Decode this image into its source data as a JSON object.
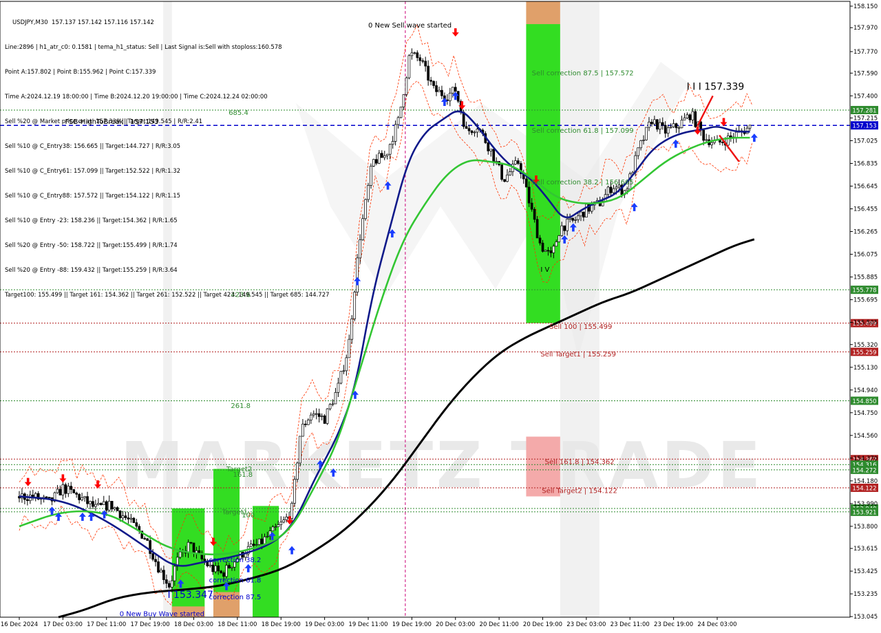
{
  "header_lines": [
    "USDJPY,M30  157.137 157.142 157.116 157.142",
    "Line:2896 | h1_atr_c0: 0.1581 | tema_h1_status: Sell | Last Signal is:Sell with stoploss:160.578",
    "Point A:157.802 | Point B:155.962 | Point C:157.339",
    "Time A:2024.12.19 18:00:00 | Time B:2024.12.20 19:00:00 | Time C:2024.12.24 02:00:00",
    "Sell %20 @ Market price or at: 157.339 || Target:149.545 | R/R:2.41",
    "Sell %10 @ C_Entry38: 156.665 || Target:144.727 | R/R:3.05",
    "Sell %10 @ C_Entry61: 157.099 || Target:152.522 | R/R:1.32",
    "Sell %10 @ C_Entry88: 157.572 || Target:154.122 | R/R:1.15",
    "Sell %10 @ Entry -23: 158.236 || Target:154.362 | R/R:1.65",
    "Sell %20 @ Entry -50: 158.722 || Target:155.499 | R/R:1.74",
    "Sell %20 @ Entry -88: 159.432 || Target:155.259 | R/R:3.64",
    "Target100: 155.499 || Target 161: 154.362 || Target 261: 152.522 || Target 423: 149.545 || Target 685: 144.727"
  ],
  "colors": {
    "candle": "#000000",
    "ma_blue": "#101a8a",
    "ma_green": "#33c633",
    "ma_black": "#000000",
    "envelope": "#ff3300",
    "level_green": "#2e8b2e",
    "level_red": "#b22222",
    "level_blue": "#0000cc",
    "zone_green": "#33dd22",
    "zone_orange": "#e0a06a",
    "zone_pink": "#f4aaaa",
    "grey_bar": "#e8e8e8",
    "arrow_up": "#1a3dff",
    "arrow_down": "#ff0000",
    "watermark": "#cfcfcf"
  },
  "chart_data": {
    "type": "candlestick",
    "symbol": "USDJPY",
    "timeframe": "M30",
    "ylim": [
      153.04,
      158.19
    ],
    "y_ticks": [
      158.15,
      157.97,
      157.77,
      157.59,
      157.4,
      157.215,
      157.025,
      156.835,
      156.645,
      156.455,
      156.265,
      156.075,
      155.885,
      155.695,
      155.505,
      155.32,
      155.13,
      154.94,
      154.75,
      154.56,
      154.37,
      154.18,
      153.99,
      153.8,
      153.615,
      153.425,
      153.235,
      153.045
    ],
    "y_tick_labels": [
      "158.150",
      "157.970",
      "157.770",
      "157.590",
      "157.400",
      "157.215",
      "157.025",
      "156.835",
      "156.645",
      "156.455",
      "156.265",
      "156.075",
      "155.885",
      "155.695",
      "155.505",
      "155.320",
      "155.130",
      "154.940",
      "154.750",
      "154.560",
      "154.370",
      "154.180",
      "153.990",
      "153.800",
      "153.615",
      "153.425",
      "153.235",
      "153.045"
    ],
    "x_labels": [
      "16 Dec 2024",
      "17 Dec 03:00",
      "17 Dec 11:00",
      "17 Dec 19:00",
      "18 Dec 03:00",
      "18 Dec 11:00",
      "18 Dec 19:00",
      "19 Dec 03:00",
      "19 Dec 11:00",
      "19 Dec 19:00",
      "20 Dec 03:00",
      "20 Dec 11:00",
      "20 Dec 19:00",
      "23 Dec 03:00",
      "23 Dec 11:00",
      "23 Dec 19:00",
      "24 Dec 03:00"
    ],
    "x_range": [
      0,
      17
    ],
    "levels": [
      {
        "price": 157.281,
        "label": "157.281",
        "color": "#2e8b2e",
        "style": "dotted"
      },
      {
        "price": 157.153,
        "label": "157.153",
        "color": "#0000cc",
        "style": "dashed"
      },
      {
        "price": 155.778,
        "label": "155.778",
        "color": "#2e8b2e",
        "style": "dotted"
      },
      {
        "price": 155.499,
        "label": "155.499",
        "color": "#b22222",
        "style": "dotted"
      },
      {
        "price": 155.259,
        "label": "155.259",
        "color": "#b22222",
        "style": "dotted"
      },
      {
        "price": 154.85,
        "label": "154.850",
        "color": "#2e8b2e",
        "style": "dotted"
      },
      {
        "price": 154.362,
        "label": "154.362",
        "color": "#b22222",
        "style": "dotted"
      },
      {
        "price": 154.316,
        "label": "154.316",
        "color": "#2e8b2e",
        "style": "dotted"
      },
      {
        "price": 154.272,
        "label": "154.272",
        "color": "#2e8b2e",
        "style": "dotted"
      },
      {
        "price": 154.122,
        "label": "154.122",
        "color": "#b22222",
        "style": "dotted"
      },
      {
        "price": 153.949,
        "label": "153.949",
        "color": "#2e8b2e",
        "style": "dotted"
      },
      {
        "price": 153.921,
        "label": "153.921",
        "color": "#2e8b2e",
        "style": "dotted"
      }
    ],
    "annotations": [
      {
        "text": "FSB-HighToBreak | 157.153",
        "x": 1.05,
        "price": 157.165,
        "color": "#000000"
      },
      {
        "text": "685.4",
        "x": 4.8,
        "price": 157.24,
        "color": "#2e8b2e"
      },
      {
        "text": "423.6",
        "x": 4.85,
        "price": 155.72,
        "color": "#2e8b2e"
      },
      {
        "text": "261.8",
        "x": 4.85,
        "price": 154.79,
        "color": "#2e8b2e"
      },
      {
        "text": "Target2",
        "x": 4.75,
        "price": 154.26,
        "color": "#2e8b2e"
      },
      {
        "text": "161.8",
        "x": 4.9,
        "price": 154.215,
        "color": "#2e8b2e"
      },
      {
        "text": "Target1",
        "x": 4.65,
        "price": 153.9,
        "color": "#2e8b2e"
      },
      {
        "text": "100",
        "x": 5.1,
        "price": 153.875,
        "color": "#2e8b2e"
      },
      {
        "text": "0 New Sell wave started",
        "x": 8.0,
        "price": 157.97,
        "color": "#000000"
      },
      {
        "text": "Sell correction 87.5 | 157.572",
        "x": 11.75,
        "price": 157.57,
        "color": "#2e8b2e"
      },
      {
        "text": "Sell correction 61.8 | 157.099",
        "x": 11.75,
        "price": 157.09,
        "color": "#2e8b2e"
      },
      {
        "text": "Sell correction 38.2 | 156.665",
        "x": 11.75,
        "price": 156.66,
        "color": "#2e8b2e"
      },
      {
        "text": "Sell 100 | 155.499",
        "x": 12.15,
        "price": 155.45,
        "color": "#b22222"
      },
      {
        "text": "Sell Target1 | 155.259",
        "x": 11.95,
        "price": 155.22,
        "color": "#b22222"
      },
      {
        "text": "Sell 161.8 | 154.362",
        "x": 12.05,
        "price": 154.32,
        "color": "#b22222"
      },
      {
        "text": "Sell Target2 | 154.122",
        "x": 11.98,
        "price": 154.08,
        "color": "#b22222"
      },
      {
        "text": "I V",
        "x": 11.95,
        "price": 155.93,
        "color": "#000000"
      },
      {
        "text": "I I I 157.339",
        "x": 15.3,
        "price": 157.45,
        "color": "#000000"
      },
      {
        "text": "correction 38.2",
        "x": 4.35,
        "price": 153.5,
        "color": "#0000cc"
      },
      {
        "text": "correction 61.8",
        "x": 4.35,
        "price": 153.33,
        "color": "#0000cc"
      },
      {
        "text": "correction 87.5",
        "x": 4.35,
        "price": 153.19,
        "color": "#0000cc"
      },
      {
        "text": "0 New Buy Wave started",
        "x": 2.3,
        "price": 153.05,
        "color": "#0000cc"
      },
      {
        "text": "I 153.347",
        "x": 3.4,
        "price": 153.2,
        "color": "#0000cc"
      }
    ],
    "zones": [
      {
        "x0": 11.62,
        "x1": 12.4,
        "y0": 155.499,
        "y1": 158.0,
        "color": "#33dd22"
      },
      {
        "x0": 11.62,
        "x1": 12.4,
        "y0": 158.0,
        "y1": 158.19,
        "color": "#e0a06a"
      },
      {
        "x0": 11.62,
        "x1": 12.4,
        "y0": 154.05,
        "y1": 154.55,
        "color": "#f4aaaa"
      },
      {
        "x0": 3.5,
        "x1": 4.25,
        "y0": 153.04,
        "y1": 153.95,
        "color": "#33dd22"
      },
      {
        "x0": 3.5,
        "x1": 4.25,
        "y0": 153.04,
        "y1": 153.13,
        "color": "#e0a06a"
      },
      {
        "x0": 4.45,
        "x1": 5.05,
        "y0": 153.04,
        "y1": 154.28,
        "color": "#33dd22"
      },
      {
        "x0": 4.45,
        "x1": 5.05,
        "y0": 153.04,
        "y1": 153.25,
        "color": "#e0a06a"
      },
      {
        "x0": 5.35,
        "x1": 5.95,
        "y0": 153.04,
        "y1": 153.97,
        "color": "#33dd22"
      }
    ],
    "grey_bars": [
      {
        "x0": 12.4,
        "x1": 13.3
      },
      {
        "x0": 3.3,
        "x1": 3.5
      }
    ],
    "vlines": [
      {
        "x": 8.85,
        "color": "#cc0077",
        "style": "dashed"
      }
    ],
    "close_path": [
      [
        0,
        154.05
      ],
      [
        0.3,
        154.05
      ],
      [
        0.7,
        154.0
      ],
      [
        1.0,
        154.12
      ],
      [
        1.35,
        154.05
      ],
      [
        1.75,
        153.95
      ],
      [
        2.1,
        153.98
      ],
      [
        2.5,
        153.85
      ],
      [
        2.9,
        153.7
      ],
      [
        3.2,
        153.45
      ],
      [
        3.45,
        153.3
      ],
      [
        3.6,
        153.5
      ],
      [
        3.9,
        153.65
      ],
      [
        4.1,
        153.55
      ],
      [
        4.4,
        153.45
      ],
      [
        4.65,
        153.4
      ],
      [
        4.9,
        153.5
      ],
      [
        5.2,
        153.6
      ],
      [
        5.5,
        153.65
      ],
      [
        5.8,
        153.75
      ],
      [
        6.1,
        153.85
      ],
      [
        6.25,
        153.95
      ],
      [
        6.45,
        154.6
      ],
      [
        6.7,
        154.75
      ],
      [
        7.0,
        154.7
      ],
      [
        7.3,
        154.95
      ],
      [
        7.55,
        155.3
      ],
      [
        7.8,
        156.2
      ],
      [
        8.1,
        156.85
      ],
      [
        8.4,
        156.9
      ],
      [
        8.7,
        157.2
      ],
      [
        8.95,
        157.75
      ],
      [
        9.2,
        157.7
      ],
      [
        9.5,
        157.45
      ],
      [
        9.8,
        157.4
      ],
      [
        10.0,
        157.45
      ],
      [
        10.25,
        157.1
      ],
      [
        10.5,
        157.15
      ],
      [
        10.8,
        156.95
      ],
      [
        11.1,
        156.7
      ],
      [
        11.45,
        156.85
      ],
      [
        11.7,
        156.5
      ],
      [
        11.95,
        156.15
      ],
      [
        12.2,
        156.05
      ],
      [
        12.4,
        156.3
      ],
      [
        12.7,
        156.35
      ],
      [
        13.0,
        156.45
      ],
      [
        13.3,
        156.5
      ],
      [
        13.6,
        156.65
      ],
      [
        13.9,
        156.6
      ],
      [
        14.2,
        156.95
      ],
      [
        14.5,
        157.2
      ],
      [
        14.8,
        157.1
      ],
      [
        15.1,
        157.15
      ],
      [
        15.4,
        157.25
      ],
      [
        15.7,
        157.05
      ],
      [
        16.0,
        157.0
      ],
      [
        16.3,
        157.05
      ],
      [
        16.55,
        157.1
      ],
      [
        16.75,
        157.14
      ]
    ],
    "series": [
      {
        "color": "#101a8a",
        "values": [
          [
            0,
            154.05
          ],
          [
            1.0,
            154.02
          ],
          [
            2.0,
            153.85
          ],
          [
            3.0,
            153.6
          ],
          [
            3.6,
            153.45
          ],
          [
            4.2,
            153.5
          ],
          [
            5.0,
            153.55
          ],
          [
            5.8,
            153.65
          ],
          [
            6.3,
            153.82
          ],
          [
            6.8,
            154.22
          ],
          [
            7.3,
            154.55
          ],
          [
            7.7,
            154.95
          ],
          [
            8.1,
            155.75
          ],
          [
            8.5,
            156.3
          ],
          [
            8.9,
            156.85
          ],
          [
            9.3,
            157.1
          ],
          [
            9.7,
            157.2
          ],
          [
            10.1,
            157.3
          ],
          [
            10.5,
            157.15
          ],
          [
            10.9,
            156.95
          ],
          [
            11.3,
            156.8
          ],
          [
            11.7,
            156.72
          ],
          [
            12.1,
            156.55
          ],
          [
            12.5,
            156.35
          ],
          [
            12.9,
            156.45
          ],
          [
            13.3,
            156.52
          ],
          [
            13.7,
            156.58
          ],
          [
            14.1,
            156.75
          ],
          [
            14.5,
            156.95
          ],
          [
            14.9,
            157.05
          ],
          [
            15.3,
            157.1
          ],
          [
            15.7,
            157.12
          ],
          [
            16.0,
            157.15
          ],
          [
            16.4,
            157.1
          ],
          [
            16.75,
            157.1
          ]
        ]
      },
      {
        "color": "#33c633",
        "values": [
          [
            0,
            153.8
          ],
          [
            1.0,
            153.93
          ],
          [
            2.0,
            153.92
          ],
          [
            2.8,
            153.75
          ],
          [
            3.5,
            153.6
          ],
          [
            4.5,
            153.55
          ],
          [
            5.5,
            153.62
          ],
          [
            6.2,
            153.75
          ],
          [
            6.8,
            154.15
          ],
          [
            7.3,
            154.5
          ],
          [
            7.8,
            155.1
          ],
          [
            8.3,
            155.7
          ],
          [
            8.8,
            156.2
          ],
          [
            9.3,
            156.5
          ],
          [
            9.8,
            156.75
          ],
          [
            10.3,
            156.87
          ],
          [
            10.8,
            156.85
          ],
          [
            11.3,
            156.82
          ],
          [
            11.8,
            156.7
          ],
          [
            12.3,
            156.55
          ],
          [
            12.8,
            156.5
          ],
          [
            13.3,
            156.5
          ],
          [
            13.8,
            156.55
          ],
          [
            14.3,
            156.7
          ],
          [
            14.8,
            156.85
          ],
          [
            15.3,
            156.95
          ],
          [
            15.8,
            157.02
          ],
          [
            16.3,
            157.05
          ],
          [
            16.75,
            157.05
          ]
        ]
      },
      {
        "color": "#000000",
        "values": [
          [
            0.9,
            153.04
          ],
          [
            1.5,
            153.1
          ],
          [
            2.2,
            153.2
          ],
          [
            3.0,
            153.25
          ],
          [
            3.8,
            153.27
          ],
          [
            4.6,
            153.3
          ],
          [
            5.4,
            153.37
          ],
          [
            6.1,
            153.45
          ],
          [
            6.8,
            153.6
          ],
          [
            7.4,
            153.75
          ],
          [
            8.0,
            153.95
          ],
          [
            8.6,
            154.2
          ],
          [
            9.2,
            154.5
          ],
          [
            9.8,
            154.8
          ],
          [
            10.4,
            155.05
          ],
          [
            11.0,
            155.25
          ],
          [
            11.6,
            155.38
          ],
          [
            12.2,
            155.48
          ],
          [
            12.8,
            155.58
          ],
          [
            13.4,
            155.68
          ],
          [
            14.0,
            155.75
          ],
          [
            14.6,
            155.85
          ],
          [
            15.2,
            155.95
          ],
          [
            15.8,
            156.05
          ],
          [
            16.4,
            156.15
          ],
          [
            16.85,
            156.2
          ]
        ]
      }
    ],
    "arrows_up": [
      [
        0.75,
        153.93
      ],
      [
        0.9,
        153.88
      ],
      [
        1.45,
        153.88
      ],
      [
        1.65,
        153.88
      ],
      [
        1.95,
        153.9
      ],
      [
        3.7,
        153.32
      ],
      [
        4.75,
        153.3
      ],
      [
        5.25,
        153.45
      ],
      [
        5.8,
        153.72
      ],
      [
        6.25,
        153.6
      ],
      [
        6.9,
        154.32
      ],
      [
        7.2,
        154.25
      ],
      [
        7.7,
        154.9
      ],
      [
        7.75,
        155.85
      ],
      [
        8.45,
        156.65
      ],
      [
        8.55,
        156.25
      ],
      [
        9.75,
        157.35
      ],
      [
        10.0,
        157.4
      ],
      [
        12.5,
        156.2
      ],
      [
        12.7,
        156.3
      ],
      [
        14.1,
        156.47
      ],
      [
        15.05,
        157.0
      ],
      [
        16.85,
        157.05
      ]
    ],
    "arrows_down": [
      [
        0.2,
        154.17
      ],
      [
        1.0,
        154.2
      ],
      [
        1.8,
        154.15
      ],
      [
        4.45,
        153.67
      ],
      [
        6.2,
        153.85
      ],
      [
        10.0,
        157.93
      ],
      [
        10.15,
        157.32
      ],
      [
        11.85,
        156.7
      ],
      [
        15.55,
        157.11
      ],
      [
        16.15,
        157.18
      ]
    ],
    "watermark": "MARKETZ TRADE"
  }
}
